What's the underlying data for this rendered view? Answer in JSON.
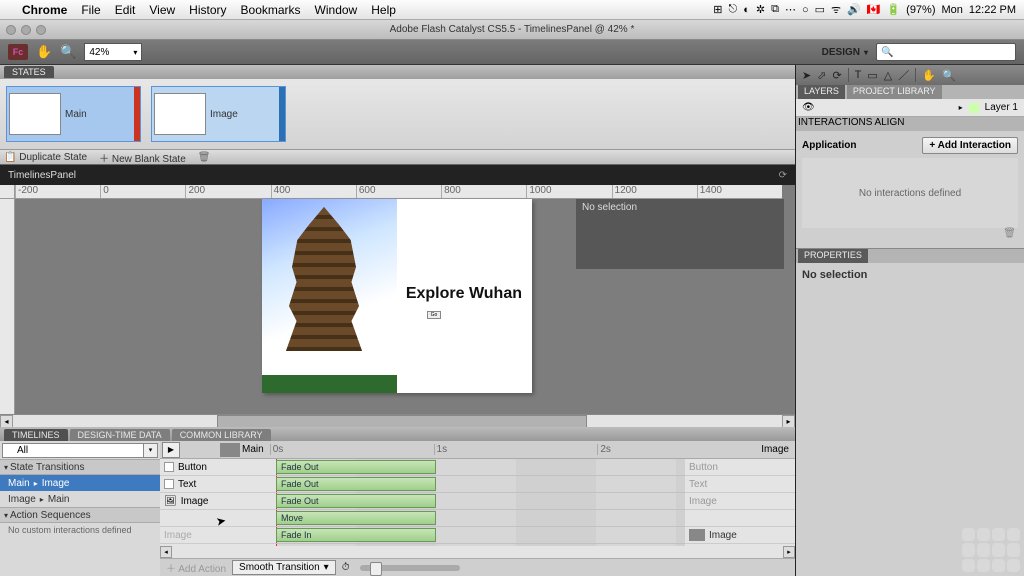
{
  "mac": {
    "app": "Chrome",
    "menus": [
      "File",
      "Edit",
      "View",
      "History",
      "Bookmarks",
      "Window",
      "Help"
    ],
    "tray": {
      "flag": "🇨🇦",
      "battery": "(97%)",
      "day": "Mon",
      "time": "12:22 PM"
    }
  },
  "window": {
    "title": "Adobe Flash Catalyst CS5.5 - TimelinesPanel @ 42% *"
  },
  "toolbar": {
    "logo": "Fc",
    "zoom": "42%",
    "mode": "DESIGN"
  },
  "states": {
    "title": "STATES",
    "items": [
      {
        "label": "Main",
        "selected": true
      },
      {
        "label": "Image",
        "selected": false
      }
    ],
    "dup": "Duplicate State",
    "blank": "New Blank State"
  },
  "doc": {
    "name": "TimelinesPanel"
  },
  "ruler": [
    "-200",
    "0",
    "200",
    "400",
    "600",
    "800",
    "1000",
    "1200",
    "1400"
  ],
  "artboard": {
    "title": "Explore Wuhan",
    "go": "Go"
  },
  "selbox": "No selection",
  "bottom": {
    "tabs": [
      "TIMELINES",
      "DESIGN-TIME DATA",
      "COMMON LIBRARY"
    ],
    "searchValue": "All",
    "stateTransHdr": "State Transitions",
    "trans": [
      {
        "from": "Main",
        "to": "Image",
        "sel": true
      },
      {
        "from": "Image",
        "to": "Main",
        "sel": false
      }
    ],
    "actionSeqHdr": "Action Sequences",
    "actionSeqNote": "No custom interactions defined",
    "leftLabel": "Main",
    "rightLabel": "Image",
    "ticks": [
      "0s",
      "1s",
      "2s"
    ],
    "rows": [
      {
        "name": "Button",
        "clip": "Fade Out",
        "right": "Button"
      },
      {
        "name": "Text",
        "clip": "Fade Out",
        "right": "Text"
      },
      {
        "name": "Image",
        "clip": "Fade Out",
        "right": "Image"
      },
      {
        "name": "",
        "clip": "Move",
        "right": ""
      },
      {
        "name": "Image",
        "dim": true,
        "clip": "Fade In",
        "right": "Image",
        "rightActive": true
      }
    ],
    "addAction": "Add Action",
    "smooth": "Smooth Transition"
  },
  "right": {
    "layersTab": "LAYERS",
    "libTab": "PROJECT LIBRARY",
    "layerName": "Layer 1",
    "interTab": "INTERACTIONS",
    "alignTab": "ALIGN",
    "appHdr": "Application",
    "addInter": "+  Add Interaction",
    "noInter": "No interactions defined",
    "propsTab": "PROPERTIES",
    "propsBody": "No selection"
  }
}
